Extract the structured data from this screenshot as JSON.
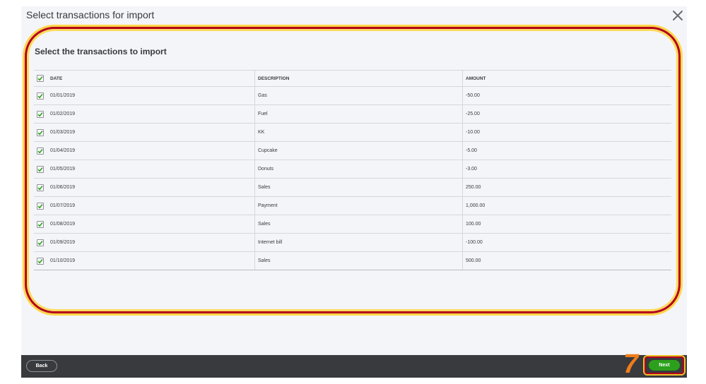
{
  "dialog": {
    "title": "Select transactions for import"
  },
  "section": {
    "heading": "Select the transactions to import"
  },
  "table": {
    "columns": {
      "date": "DATE",
      "description": "DESCRIPTION",
      "amount": "AMOUNT"
    },
    "rows": [
      {
        "date": "01/01/2019",
        "description": "Gas",
        "amount": "-50.00",
        "checked": true
      },
      {
        "date": "01/02/2019",
        "description": "Fuel",
        "amount": "-25.00",
        "checked": true
      },
      {
        "date": "01/03/2019",
        "description": "KK",
        "amount": "-10.00",
        "checked": true
      },
      {
        "date": "01/04/2019",
        "description": "Cupcake",
        "amount": "-5.00",
        "checked": true
      },
      {
        "date": "01/05/2019",
        "description": "Donuts",
        "amount": "-3.00",
        "checked": true
      },
      {
        "date": "01/06/2019",
        "description": "Sales",
        "amount": "250.00",
        "checked": true
      },
      {
        "date": "01/07/2019",
        "description": "Payment",
        "amount": "1,000.00",
        "checked": true
      },
      {
        "date": "01/08/2019",
        "description": "Sales",
        "amount": "100.00",
        "checked": true
      },
      {
        "date": "01/09/2019",
        "description": "Internet bill",
        "amount": "-100.00",
        "checked": true
      },
      {
        "date": "01/10/2019",
        "description": "Sales",
        "amount": "500.00",
        "checked": true
      }
    ]
  },
  "footer": {
    "back_label": "Back",
    "next_label": "Next"
  },
  "annotation": {
    "step_number": "7"
  },
  "colors": {
    "accent_green": "#2ca01c",
    "footer_bg": "#393a3d",
    "highlight_red": "#b3001b",
    "highlight_glow": "#ffd028",
    "step_orange": "#f07d1a"
  },
  "icons": {
    "close": "close-icon",
    "check": "checkmark-icon"
  }
}
